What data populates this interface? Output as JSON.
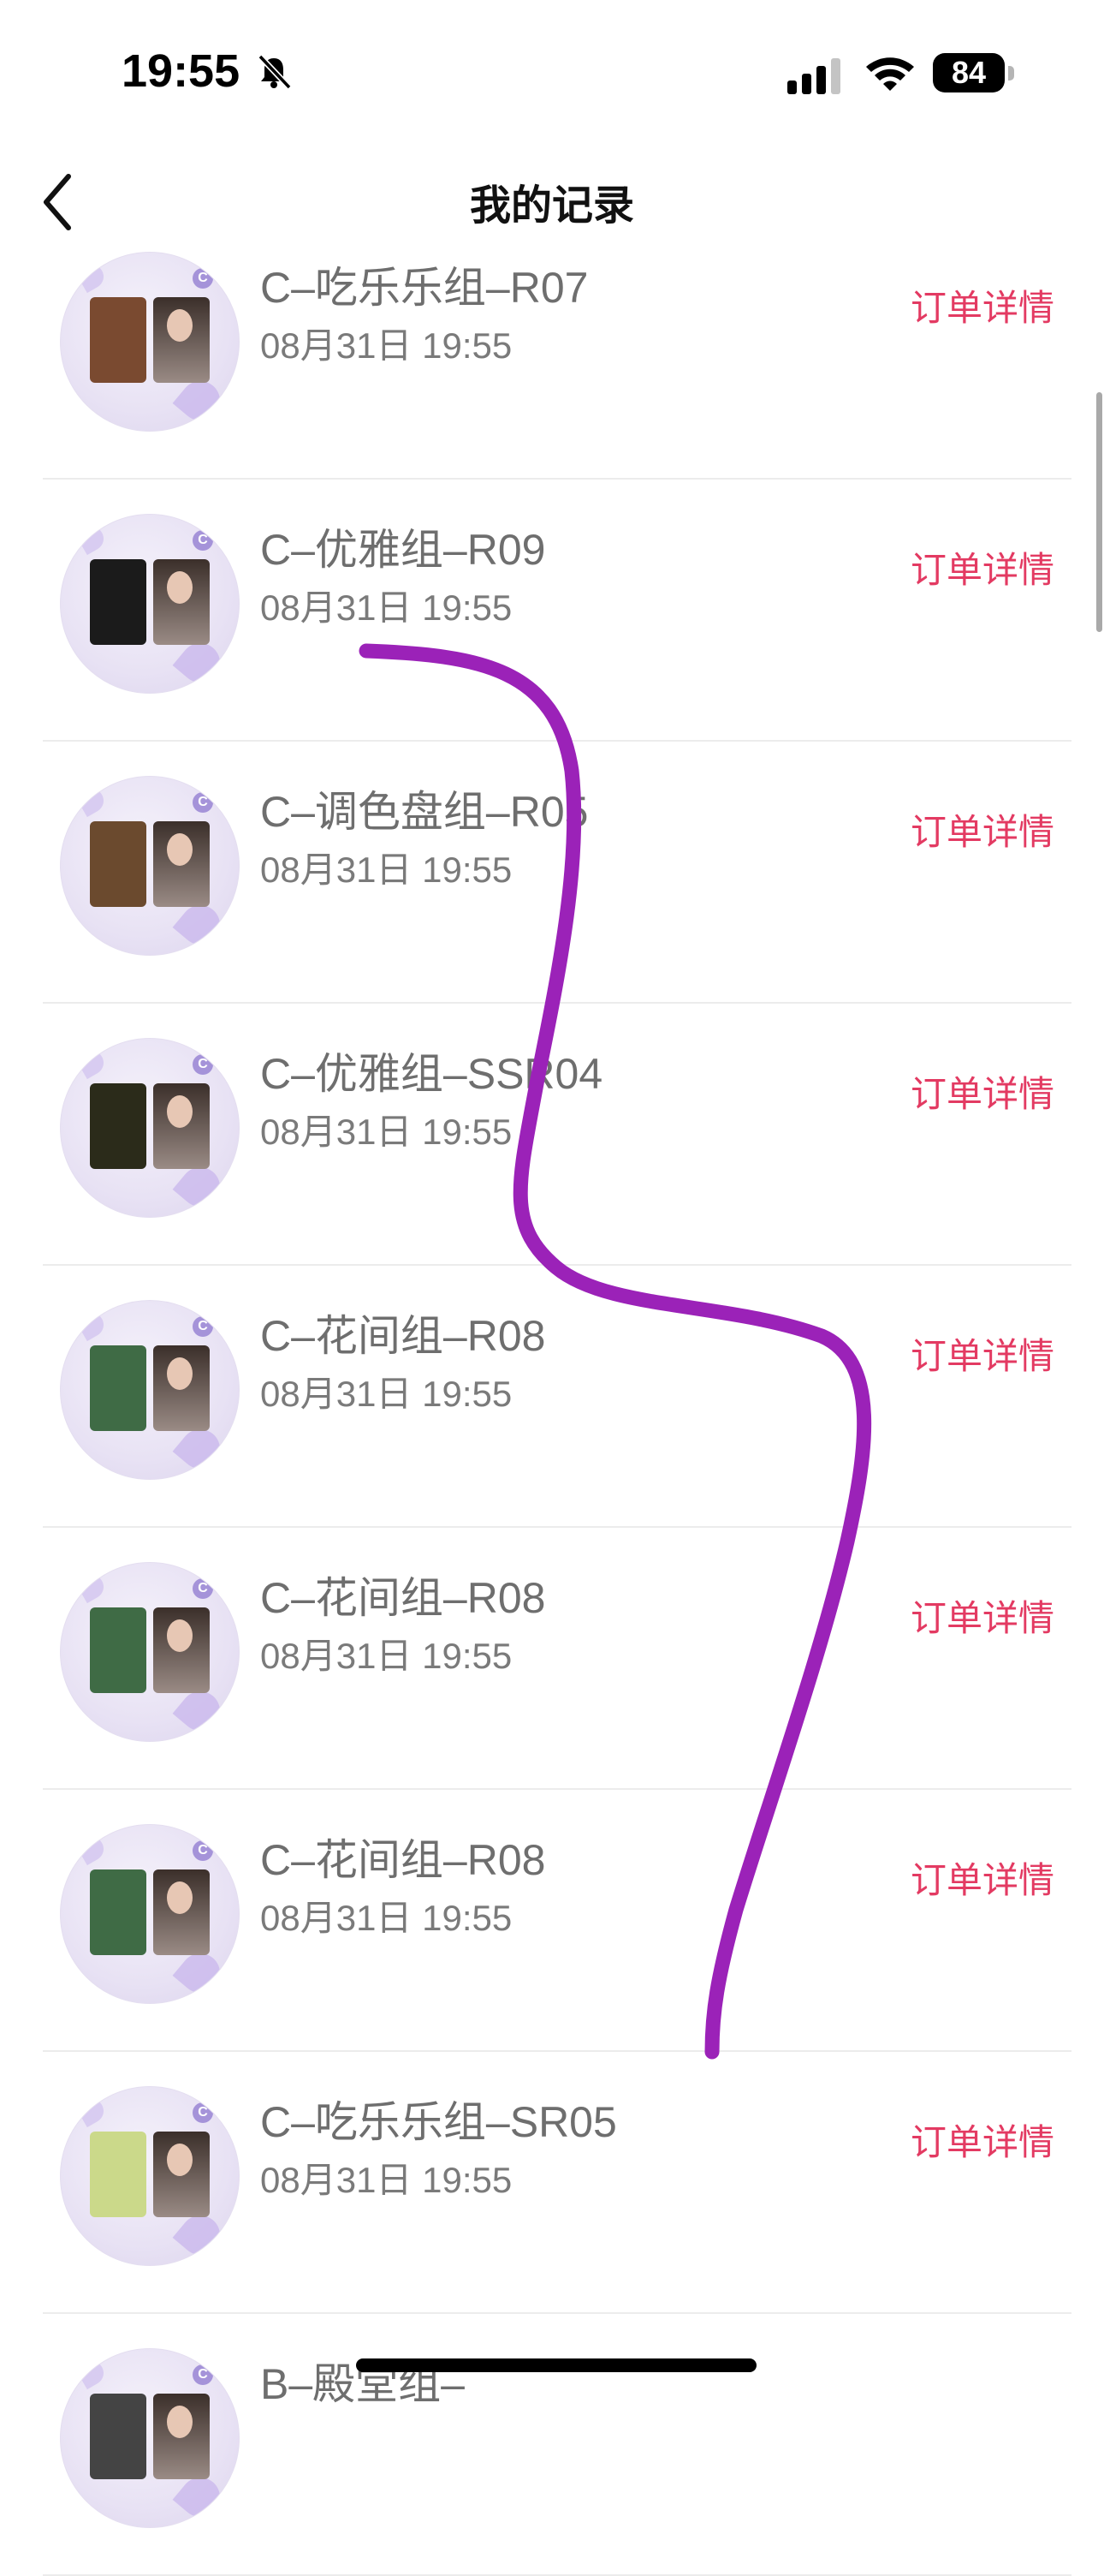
{
  "status_bar": {
    "time": "19:55",
    "battery": "84",
    "icons": [
      "bell-slash-icon",
      "cellular-signal-icon",
      "wifi-icon",
      "battery-icon"
    ]
  },
  "header": {
    "title": "我的记录",
    "back_icon": "chevron-left-icon"
  },
  "records": [
    {
      "name": "C–吃乐乐组–R07",
      "time": "08月31日 19:55",
      "action": "订单详情",
      "thumb_color": "#7a4a30"
    },
    {
      "name": "C–优雅组–R09",
      "time": "08月31日 19:55",
      "action": "订单详情",
      "thumb_color": "#1b1b1b"
    },
    {
      "name": "C–调色盘组–R05",
      "time": "08月31日 19:55",
      "action": "订单详情",
      "thumb_color": "#6b4a2e"
    },
    {
      "name": "C–优雅组–SSR04",
      "time": "08月31日 19:55",
      "action": "订单详情",
      "thumb_color": "#2b2b1a"
    },
    {
      "name": "C–花间组–R08",
      "time": "08月31日 19:55",
      "action": "订单详情",
      "thumb_color": "#3f6b45"
    },
    {
      "name": "C–花间组–R08",
      "time": "08月31日 19:55",
      "action": "订单详情",
      "thumb_color": "#3f6b45"
    },
    {
      "name": "C–花间组–R08",
      "time": "08月31日 19:55",
      "action": "订单详情",
      "thumb_color": "#3f6b45"
    },
    {
      "name": "C–吃乐乐组–SR05",
      "time": "08月31日 19:55",
      "action": "订单详情",
      "thumb_color": "#cbd98a"
    },
    {
      "name": "B–殿堂组–",
      "time": "",
      "action": "",
      "thumb_color": "#444444"
    }
  ],
  "colors": {
    "accent": "#e33a62",
    "name_text": "#6e6e6e",
    "stroke": "#9b22b8"
  }
}
